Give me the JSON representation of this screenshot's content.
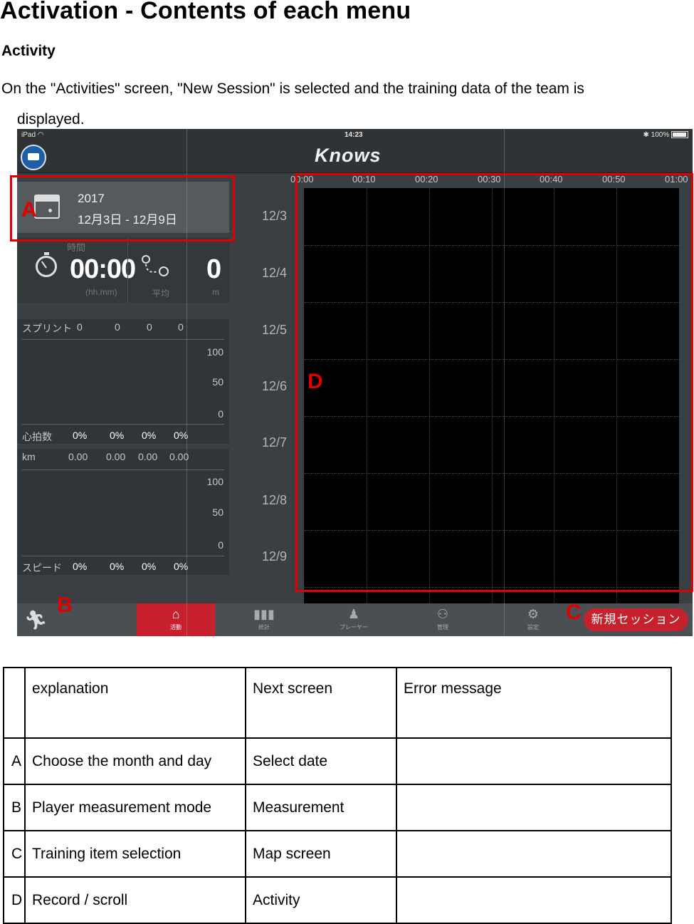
{
  "page": {
    "title": "Activation - Contents of each menu",
    "section_heading": "Activity",
    "intro_line1": "On the \"Activities\" screen, \"New Session\" is selected and the training data of the team is",
    "intro_line2": "displayed."
  },
  "ipad": {
    "status": {
      "device": "iPad",
      "time": "14:23",
      "battery": "100%"
    },
    "brand": "Knows",
    "date_card": {
      "year": "2017",
      "range": "12月3日 - 12月9日"
    },
    "stats": {
      "time_label": "時間",
      "time_value": "00:00",
      "time_unit": "(hh.mm)",
      "avg_label": "平均",
      "distance_value": "0",
      "distance_unit": "m"
    },
    "sprint_panel": {
      "label": "スプリント",
      "values": [
        "0",
        "0",
        "0",
        "0"
      ],
      "ticks": [
        "100",
        "50",
        "0"
      ],
      "footer_label": "心拍数",
      "footer_values": [
        "0%",
        "0%",
        "0%",
        "0%"
      ]
    },
    "km_panel": {
      "label": "km",
      "values": [
        "0.00",
        "0.00",
        "0.00",
        "0.00"
      ],
      "ticks": [
        "100",
        "50",
        "0"
      ],
      "footer_label": "スピード",
      "footer_values": [
        "0%",
        "0%",
        "0%",
        "0%"
      ]
    },
    "row_labels": [
      "12/3",
      "12/4",
      "12/5",
      "12/6",
      "12/7",
      "12/8",
      "12/9"
    ],
    "time_ticks": [
      "00:00",
      "00:10",
      "00:20",
      "00:30",
      "00:40",
      "00:50",
      "01:00"
    ],
    "tabs": [
      {
        "label": "活動",
        "icon": "home-icon",
        "active": true
      },
      {
        "label": "統計",
        "icon": "bar-chart-icon",
        "active": false
      },
      {
        "label": "プレーヤー",
        "icon": "player-icon",
        "active": false
      },
      {
        "label": "管理",
        "icon": "team-icon",
        "active": false
      },
      {
        "label": "設定",
        "icon": "gear-icon",
        "active": false
      }
    ],
    "new_session_label": "新規セッション",
    "callouts": {
      "a": "A",
      "b": "B",
      "c": "C",
      "d": "D"
    },
    "colors": {
      "accent": "#c8212e",
      "callout": "#e00000"
    }
  },
  "table": {
    "headers": [
      "",
      "explanation",
      "Next screen",
      "Error message"
    ],
    "rows": [
      {
        "key": "A",
        "explanation": "Choose the month and day",
        "next": "Select date",
        "error": ""
      },
      {
        "key": "B",
        "explanation": "Player measurement mode",
        "next": "Measurement",
        "error": ""
      },
      {
        "key": "C",
        "explanation": "Training item selection",
        "next": "Map screen",
        "error": ""
      },
      {
        "key": "D",
        "explanation": "Record / scroll",
        "next": "Activity",
        "error": ""
      }
    ]
  }
}
